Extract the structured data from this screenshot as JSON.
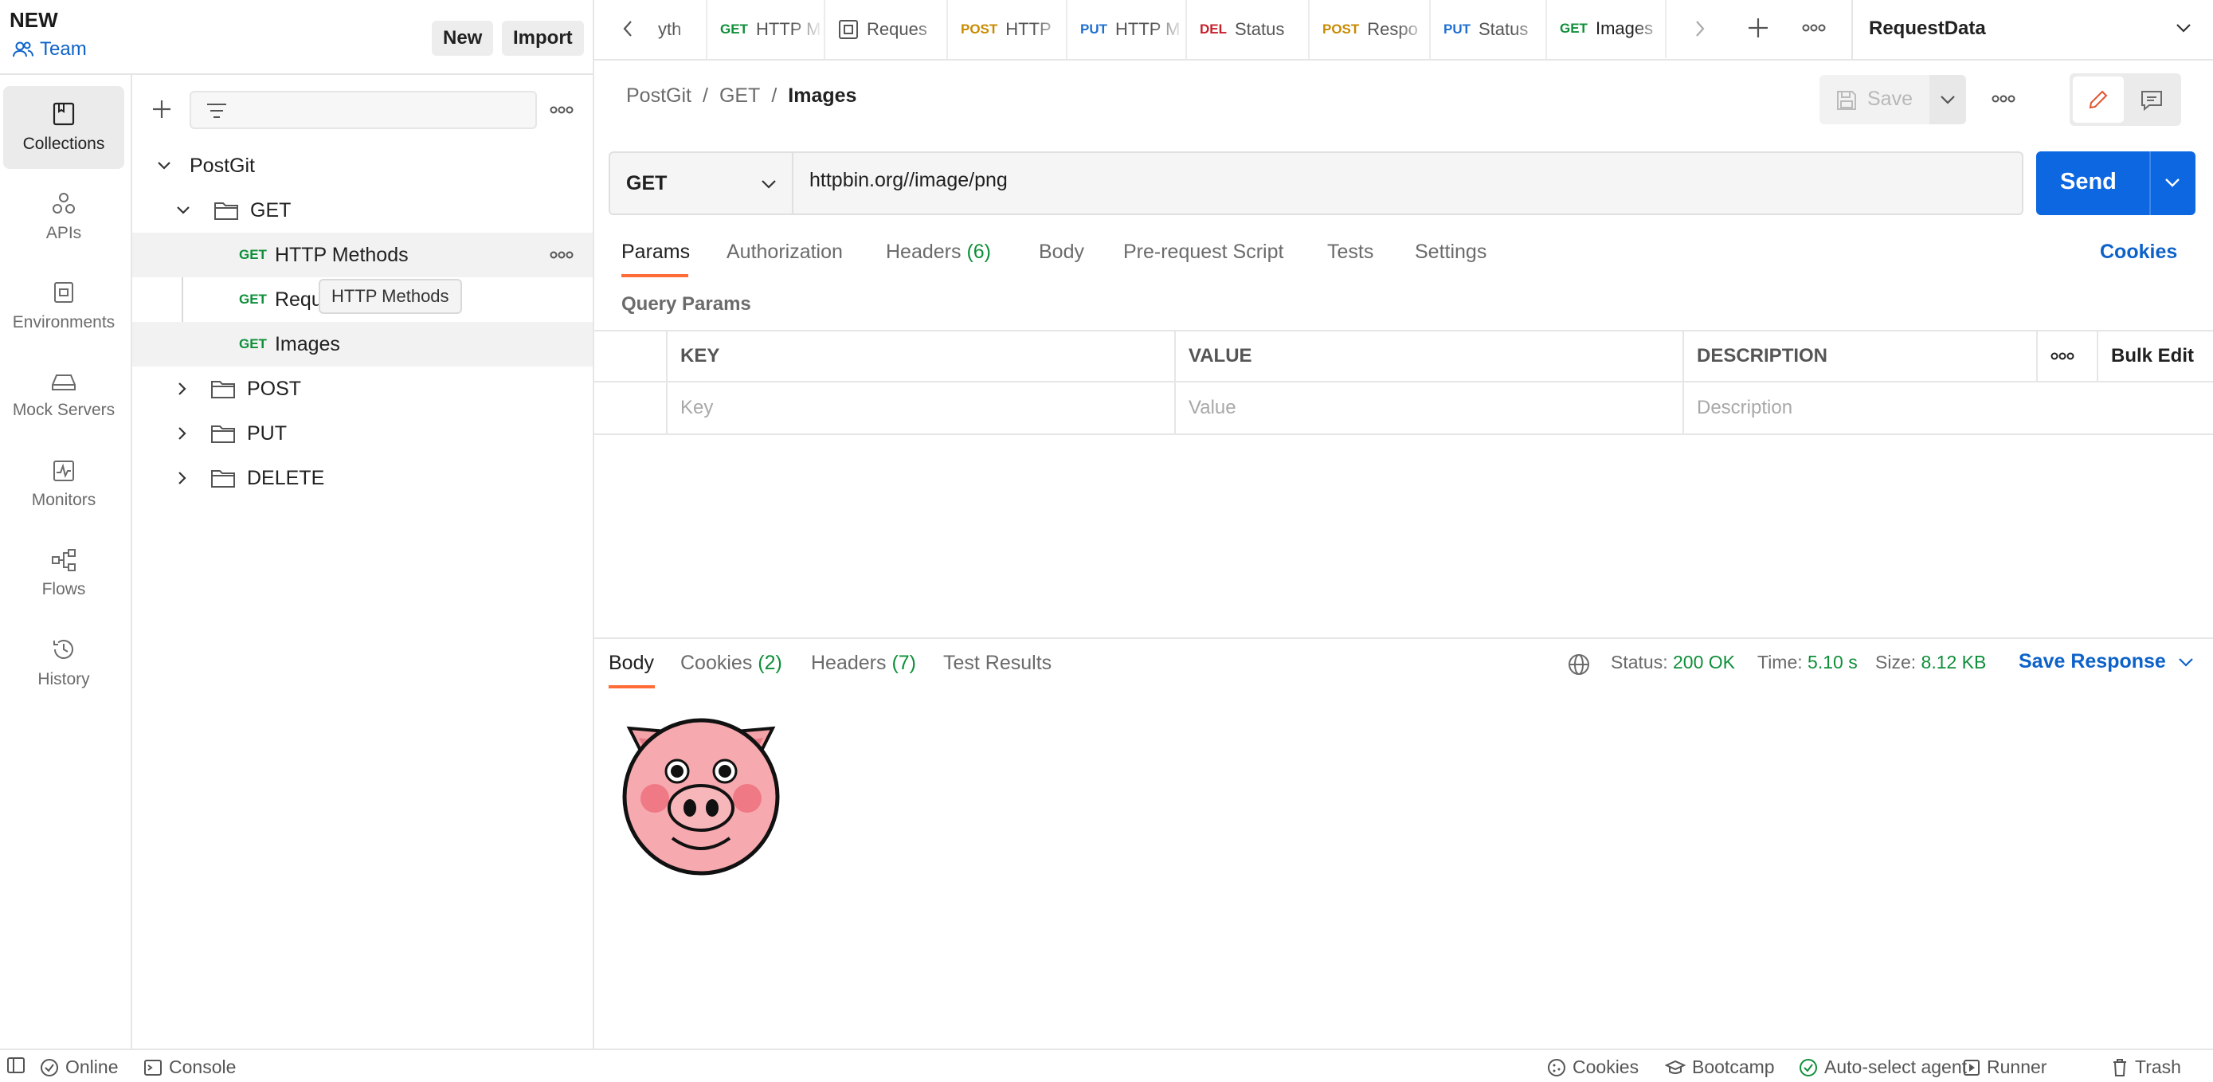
{
  "workspace": {
    "title": "NEW",
    "team_label": "Team",
    "new_label": "New",
    "import_label": "Import"
  },
  "rail": [
    {
      "label": "Collections",
      "icon": "collections-icon"
    },
    {
      "label": "APIs",
      "icon": "apis-icon"
    },
    {
      "label": "Environments",
      "icon": "environments-icon"
    },
    {
      "label": "Mock Servers",
      "icon": "mock-servers-icon"
    },
    {
      "label": "Monitors",
      "icon": "monitors-icon"
    },
    {
      "label": "Flows",
      "icon": "flows-icon"
    },
    {
      "label": "History",
      "icon": "history-icon"
    }
  ],
  "tree": {
    "collection": "PostGit",
    "get_folder": "GET",
    "requests": [
      {
        "method": "GET",
        "name": "HTTP Methods"
      },
      {
        "method": "GET",
        "name": "Requ"
      },
      {
        "method": "GET",
        "name": "Images"
      }
    ],
    "folders": [
      "POST",
      "PUT",
      "DELETE"
    ],
    "tooltip": "HTTP Methods"
  },
  "tabs": [
    {
      "method": "",
      "name": "yth"
    },
    {
      "method": "GET",
      "name": "HTTP M"
    },
    {
      "method": "",
      "name": "Reques"
    },
    {
      "method": "POST",
      "name": "HTTP"
    },
    {
      "method": "PUT",
      "name": "HTTP M"
    },
    {
      "method": "DEL",
      "name": "Status"
    },
    {
      "method": "POST",
      "name": "Respo"
    },
    {
      "method": "PUT",
      "name": "Status"
    },
    {
      "method": "GET",
      "name": "Images"
    }
  ],
  "environment": "RequestData",
  "request": {
    "breadcrumb": [
      "PostGit",
      "GET",
      "Images"
    ],
    "save_label": "Save",
    "method": "GET",
    "url": "httpbin.org//image/png",
    "send_label": "Send"
  },
  "request_tabs": {
    "params": "Params",
    "authorization": "Authorization",
    "headers": "Headers",
    "headers_count": "(6)",
    "body": "Body",
    "prerequest": "Pre-request Script",
    "tests": "Tests",
    "settings": "Settings",
    "cookies": "Cookies"
  },
  "params": {
    "title": "Query Params",
    "col_key": "KEY",
    "col_value": "VALUE",
    "col_description": "DESCRIPTION",
    "bulk_edit": "Bulk Edit",
    "ph_key": "Key",
    "ph_value": "Value",
    "ph_description": "Description"
  },
  "response": {
    "tabs": {
      "body": "Body",
      "cookies": "Cookies",
      "cookies_count": "(2)",
      "headers": "Headers",
      "headers_count": "(7)",
      "test_results": "Test Results"
    },
    "status_label": "Status:",
    "status_value": "200 OK",
    "time_label": "Time:",
    "time_value": "5.10 s",
    "size_label": "Size:",
    "size_value": "8.12 KB",
    "save_response": "Save Response"
  },
  "statusbar": {
    "online": "Online",
    "console": "Console",
    "cookies": "Cookies",
    "bootcamp": "Bootcamp",
    "auto_select": "Auto-select agent",
    "runner": "Runner",
    "trash": "Trash"
  },
  "colors": {
    "accent_blue": "#0c67e0",
    "get_green": "#0f8f3a",
    "post_orange": "#c98a00",
    "put_blue": "#1f6fd1",
    "delete_red": "#c4202b",
    "active_tab_underline": "#ff6c37"
  }
}
